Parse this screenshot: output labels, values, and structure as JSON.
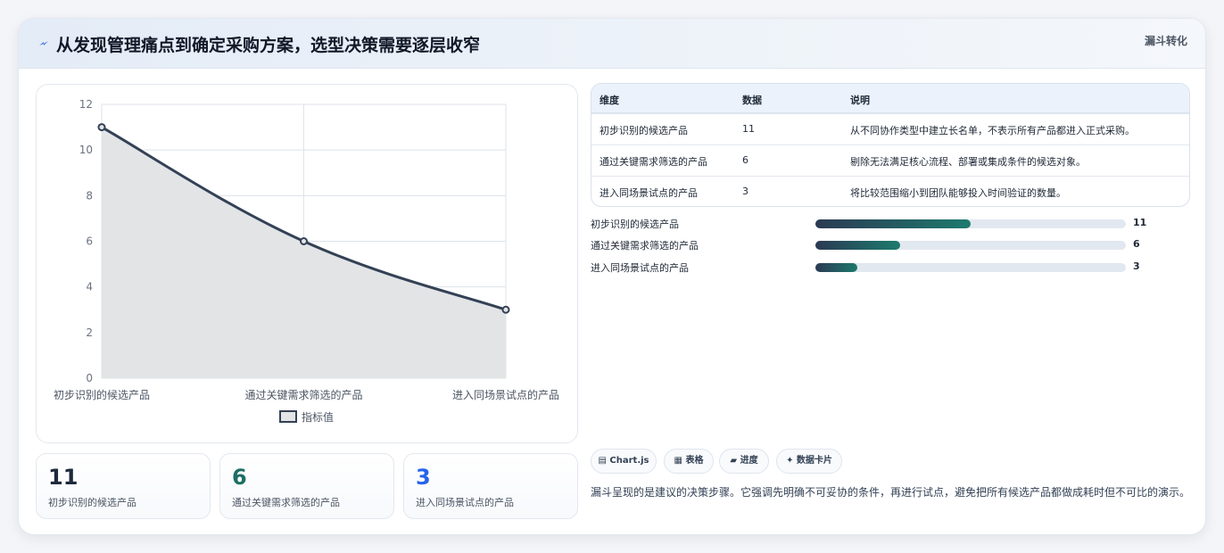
{
  "header": {
    "title": "从发现管理痛点到确定采购方案，选型决策需要逐层收窄",
    "tag": "漏斗转化",
    "icon": "bolt-icon"
  },
  "chart_data": {
    "type": "line",
    "categories": [
      "初步识别的候选产品",
      "通过关键需求筛选的产品",
      "进入同场景试点的产品"
    ],
    "series": [
      {
        "name": "指标值",
        "values": [
          11,
          6,
          3
        ]
      }
    ],
    "ylim": [
      0,
      12
    ],
    "yticks": [
      0,
      2,
      4,
      6,
      8,
      10,
      12
    ],
    "grid": true,
    "legend": "bottom",
    "line_color": "#334155",
    "fill_color": "#e2e4e6"
  },
  "stats": [
    {
      "value": "11",
      "label": "初步识别的候选产品",
      "color": "#1e293b"
    },
    {
      "value": "6",
      "label": "通过关键需求筛选的产品",
      "color": "#1d6f63"
    },
    {
      "value": "3",
      "label": "进入同场景试点的产品",
      "color": "#2563eb"
    }
  ],
  "table": {
    "headers": [
      "维度",
      "数据",
      "说明"
    ],
    "rows": [
      [
        "初步识别的候选产品",
        "11",
        "从不同协作类型中建立长名单，不表示所有产品都进入正式采购。"
      ],
      [
        "通过关键需求筛选的产品",
        "6",
        "剔除无法满足核心流程、部署或集成条件的候选对象。"
      ],
      [
        "进入同场景试点的产品",
        "3",
        "将比较范围缩小到团队能够投入时间验证的数量。"
      ]
    ]
  },
  "progress": [
    {
      "label": "初步识别的候选产品",
      "value": 11,
      "display": "11"
    },
    {
      "label": "通过关键需求筛选的产品",
      "value": 6,
      "display": "6"
    },
    {
      "label": "进入同场景试点的产品",
      "value": 3,
      "display": "3"
    }
  ],
  "progress_max": 22,
  "chips": [
    {
      "label": "▤ Chart.js"
    },
    {
      "label": "▦ 表格"
    },
    {
      "label": "▰ 进度"
    },
    {
      "label": "✦ 数据卡片"
    }
  ],
  "note": "漏斗呈现的是建议的决策步骤。它强调先明确不可妥协的条件，再进行试点，避免把所有候选产品都做成耗时但不可比的演示。"
}
